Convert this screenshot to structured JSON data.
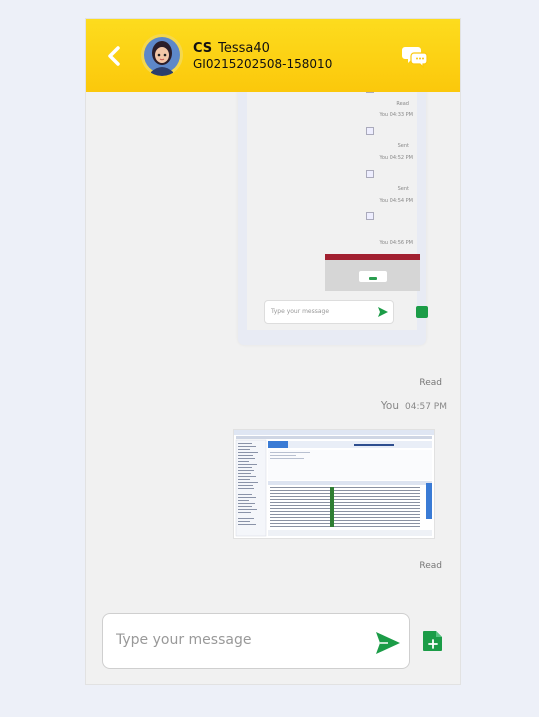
{
  "header": {
    "short_name": "CS",
    "username": "Tessa40",
    "user_id": "GI0215202508-158010"
  },
  "embedded_screenshot": {
    "statuses": [
      "Read",
      "Sent",
      "Sent"
    ],
    "times": [
      "You 04:33 PM",
      "You 04:52 PM",
      "You 04:54 PM",
      "You 04:56 PM"
    ],
    "input_placeholder": "Type your message"
  },
  "messages": {
    "status_read_1": "Read",
    "sender": "You",
    "time": "04:57 PM",
    "status_read_2": "Read"
  },
  "composer": {
    "placeholder": "Type your message"
  },
  "colors": {
    "header": "#fbc80b",
    "accent_green": "#1b9c47"
  }
}
